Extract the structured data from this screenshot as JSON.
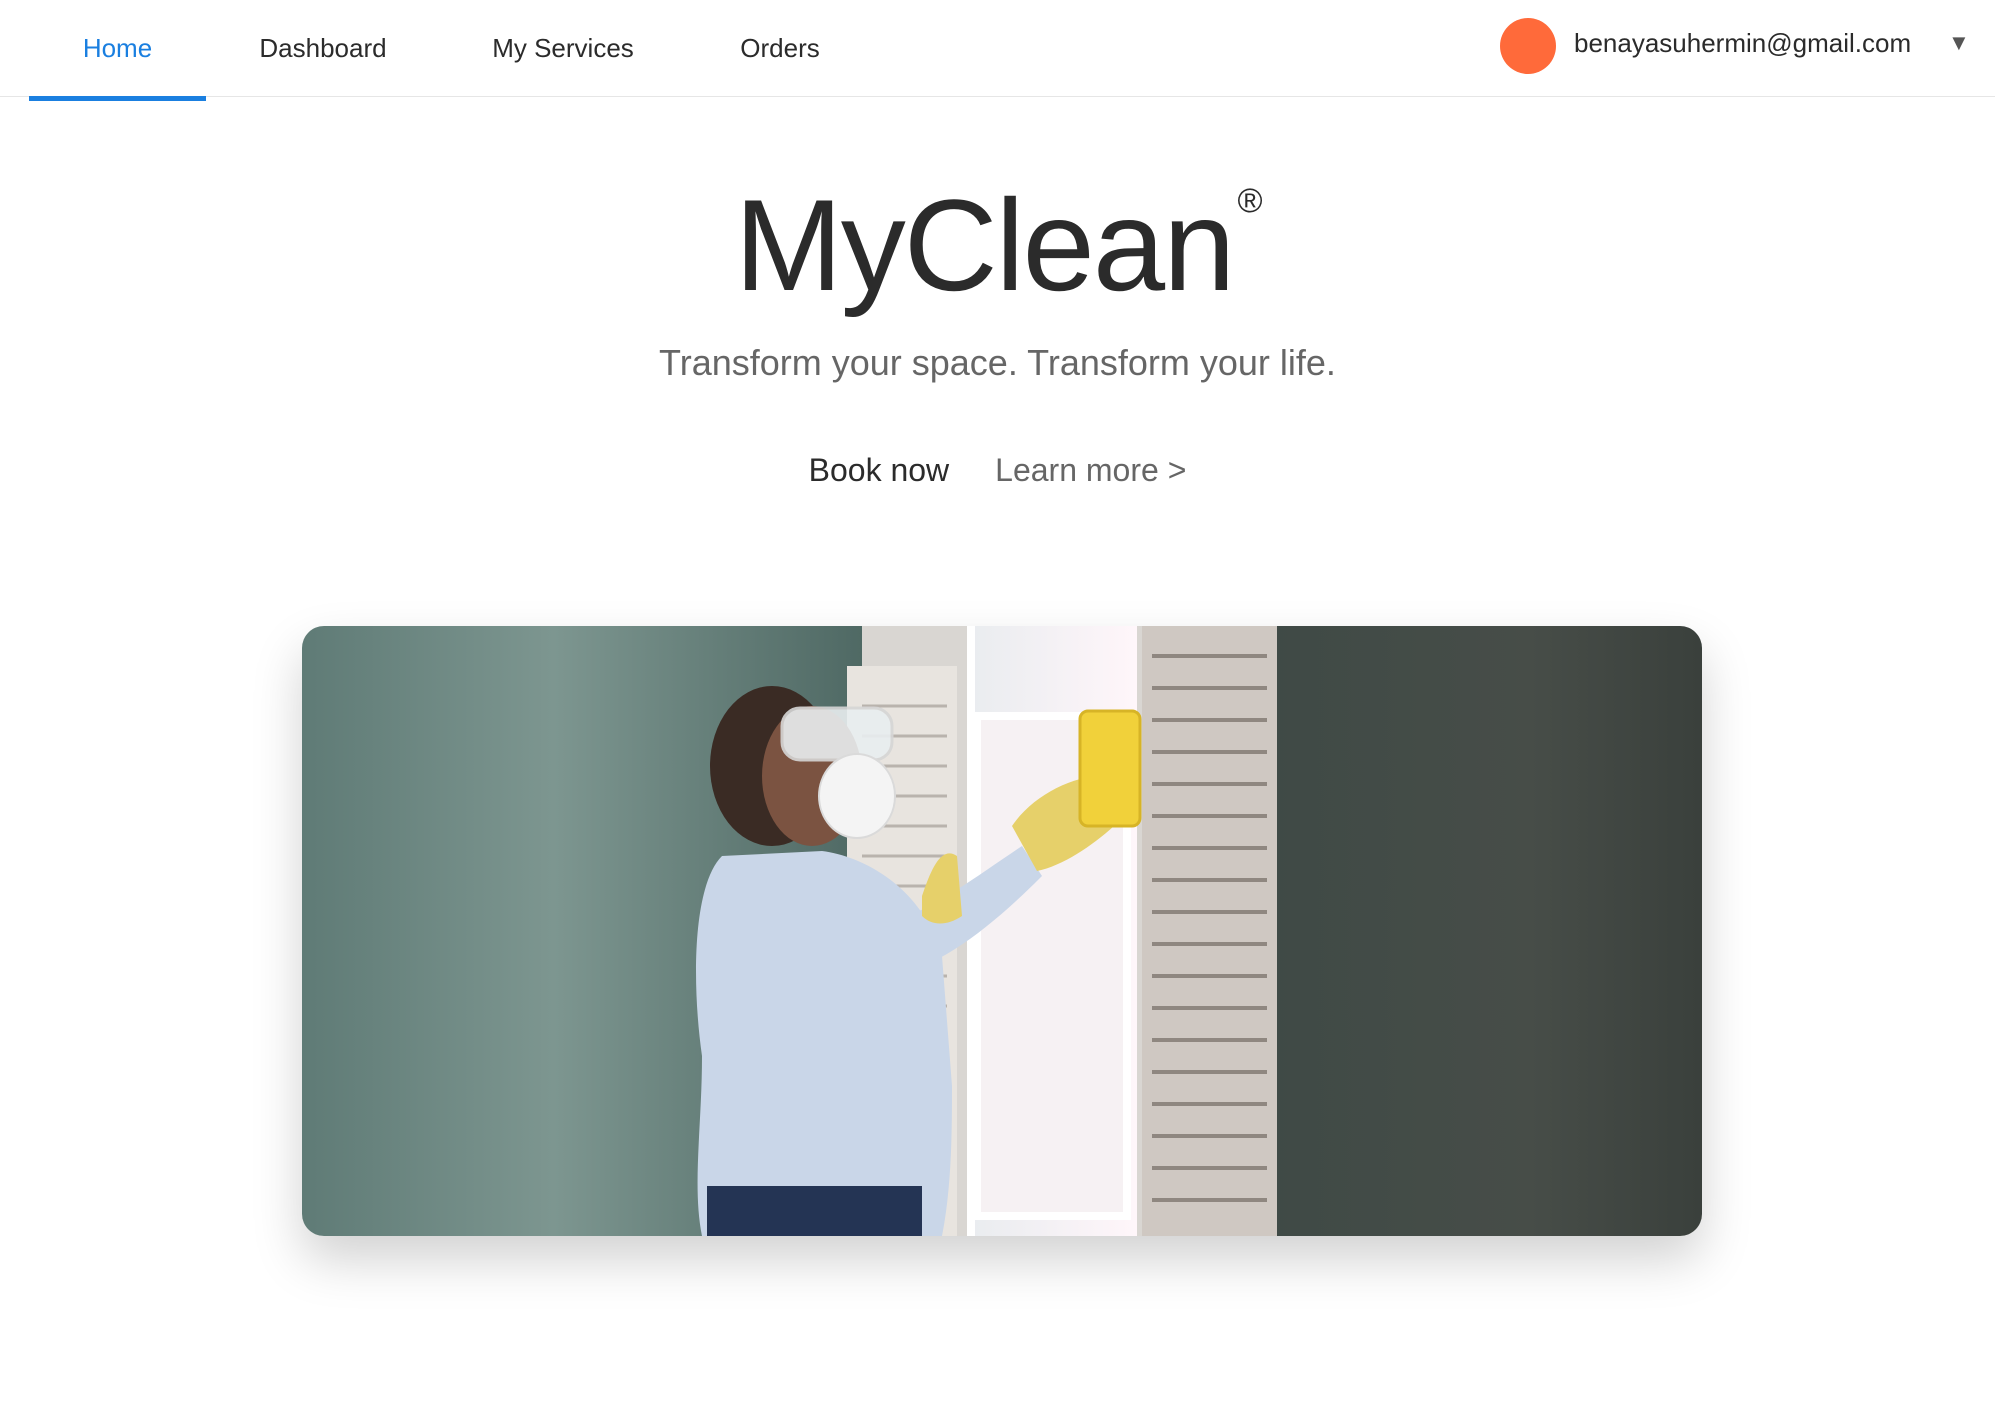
{
  "nav": {
    "tabs": [
      {
        "label": "Home",
        "active": true
      },
      {
        "label": "Dashboard",
        "active": false
      },
      {
        "label": "My Services",
        "active": false
      },
      {
        "label": "Orders",
        "active": false
      }
    ],
    "active_color": "#1a7fe0"
  },
  "user": {
    "email": "benayasuhermin@gmail.com",
    "avatar_color": "#ff6a3a",
    "menu_icon": "caret-down-icon"
  },
  "hero": {
    "title": "MyClean",
    "title_mark": "®",
    "tagline": "Transform your space. Transform your life.",
    "book_label": "Book now",
    "learn_label": "Learn more >"
  },
  "image": {
    "subject": "person cleaning a window with a yellow sponge"
  }
}
